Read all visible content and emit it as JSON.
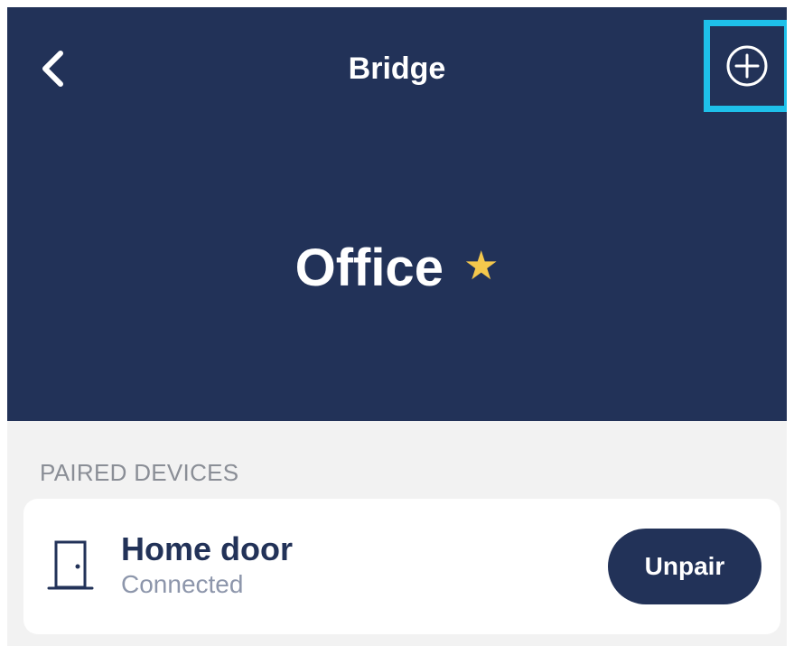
{
  "header": {
    "title": "Bridge",
    "bridge_name": "Office",
    "favorite": true,
    "back_icon": "chevron-left-icon",
    "add_icon": "plus-circle-icon",
    "favorite_icon": "star-icon"
  },
  "colors": {
    "header_background": "#223258",
    "highlight": "#1ec0ea",
    "star": "#f5c84c",
    "primary": "#223258",
    "page_background": "#f2f2f2"
  },
  "paired_devices": {
    "section_label": "PAIRED DEVICES",
    "devices": [
      {
        "name": "Home door",
        "status": "Connected",
        "icon": "door-icon",
        "action_label": "Unpair"
      }
    ]
  }
}
